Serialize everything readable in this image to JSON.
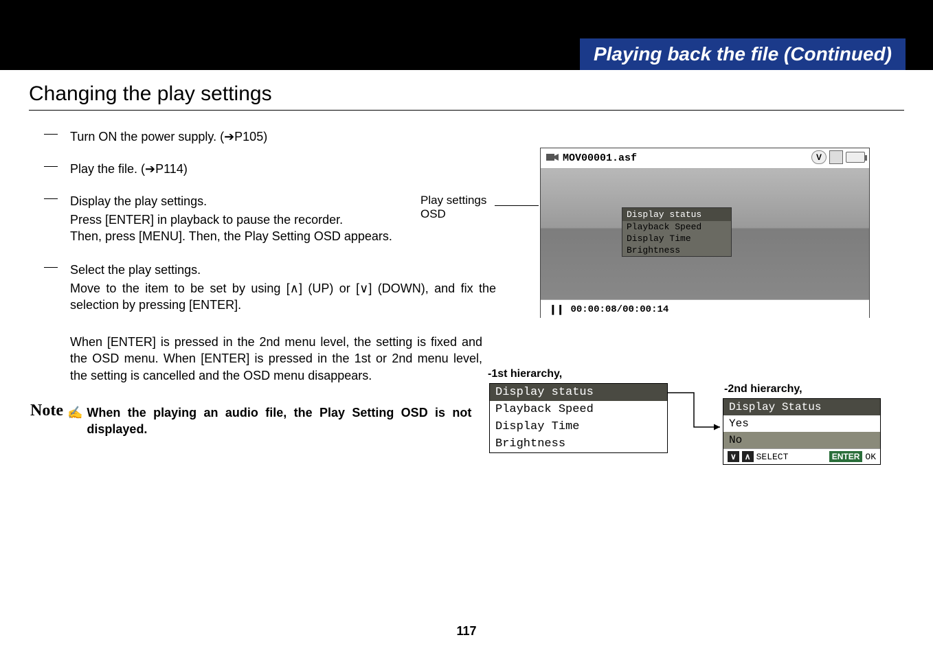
{
  "header": {
    "title": "Playing back the file (Continued)"
  },
  "section": {
    "title": "Changing the play settings"
  },
  "steps": {
    "s1": "Turn ON the power supply. (➔P105)",
    "s2": "Play the file. (➔P114)",
    "s3_head": "Display the play settings.",
    "s3_body": "Press [ENTER] in playback to pause the recorder.\nThen, press [MENU]. Then, the Play Setting OSD appears.",
    "s4_head": "Select the play settings.",
    "s4_body": "Move to the item to be set by using [∧] (UP) or [∨] (DOWN), and fix the selection by pressing [ENTER].",
    "s5_body": "When [ENTER] is pressed in the 2nd menu level, the setting is fixed and the OSD menu. When [ENTER] is pressed in the 1st or 2nd menu level, the setting is cancelled and the OSD menu disappears."
  },
  "note": {
    "label": "Note",
    "text": "When the playing an audio file, the Play Setting OSD is not displayed."
  },
  "play_settings_label": {
    "l1": "Play settings",
    "l2": "OSD"
  },
  "screenshot": {
    "filename": "MOV00001.asf",
    "icon_v": "V",
    "osd_title": "Display status",
    "osd_items": [
      "Playback Speed",
      "Display Time",
      "Brightness"
    ],
    "timecode": "00:00:08/00:00:14"
  },
  "hierarchy1": {
    "label": "-1st hierarchy,",
    "items": [
      "Display status",
      "Playback Speed",
      "Display Time",
      "Brightness"
    ],
    "selected_index": 0
  },
  "hierarchy2": {
    "label": "-2nd hierarchy,",
    "title": "Display Status",
    "options": [
      "Yes",
      "No"
    ],
    "selected_index": 1,
    "footer": {
      "down": "∨",
      "up": "∧",
      "select": "SELECT",
      "enter": "ENTER",
      "ok": "OK"
    }
  },
  "page_number": "117"
}
